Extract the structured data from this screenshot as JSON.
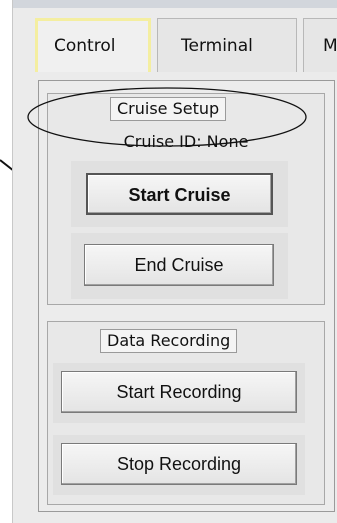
{
  "tabs": [
    {
      "label": "Control",
      "active": true
    },
    {
      "label": "Terminal",
      "active": false
    },
    {
      "label": "M",
      "active": false
    }
  ],
  "cruise_setup": {
    "legend": "Cruise Setup",
    "cruise_id_text": "Cruise ID: None",
    "start_label": "Start Cruise",
    "end_label": "End Cruise"
  },
  "data_recording": {
    "legend": "Data Recording",
    "start_label": "Start Recording",
    "stop_label": "Stop Recording"
  },
  "annotation": {
    "highlight_color": "#111111"
  }
}
